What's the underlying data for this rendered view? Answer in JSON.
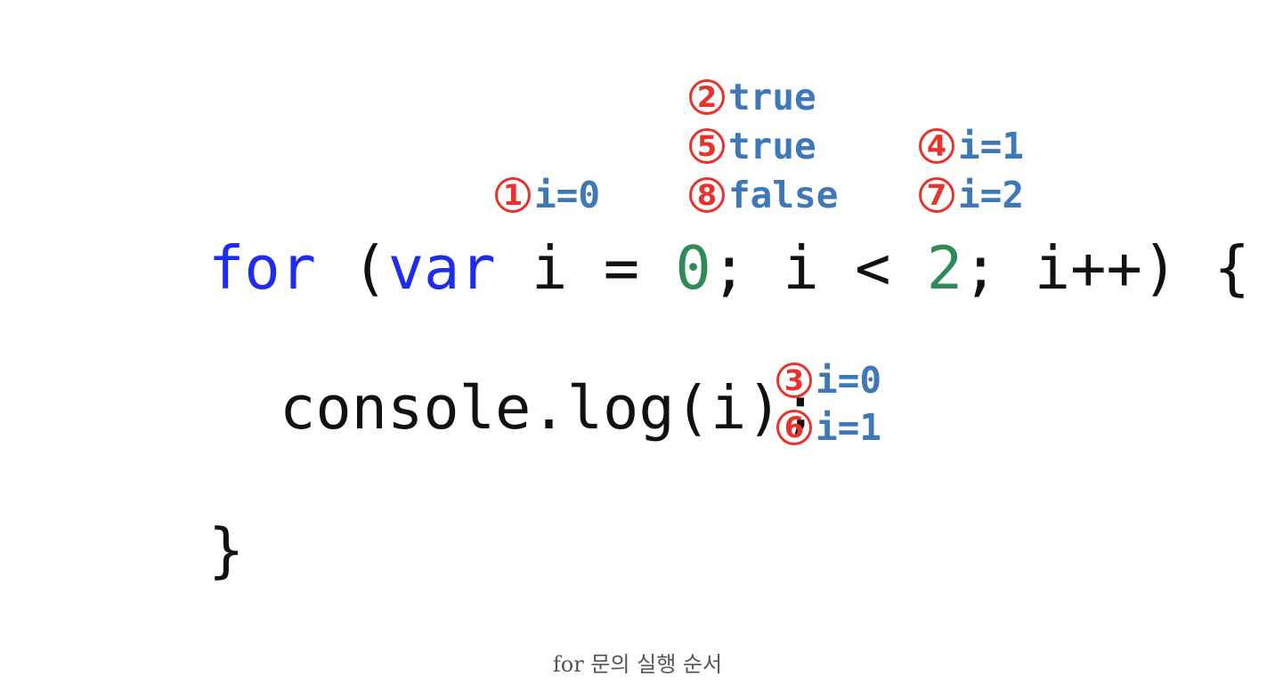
{
  "code": {
    "line1": {
      "kw_for": "for",
      "p_open": " (",
      "kw_var": "var",
      "decl": " i = ",
      "init_value": "0",
      "cond": "; i < ",
      "limit_value": "2",
      "rest": "; i++) {"
    },
    "line2": "console.log(i);",
    "line3": "}"
  },
  "annotations": [
    {
      "step": "1",
      "text": "i=0"
    },
    {
      "step": "2",
      "text": "true"
    },
    {
      "step": "3",
      "text": "i=0"
    },
    {
      "step": "4",
      "text": "i=1"
    },
    {
      "step": "5",
      "text": "true"
    },
    {
      "step": "6",
      "text": "i=1"
    },
    {
      "step": "7",
      "text": "i=2"
    },
    {
      "step": "8",
      "text": "false"
    }
  ],
  "caption": "for 문의 실행 순서",
  "colors": {
    "keyword": "#1f2cf0",
    "number": "#2e8b57",
    "annotation_text": "#3f78b8",
    "step_circle": "#e8332c"
  }
}
